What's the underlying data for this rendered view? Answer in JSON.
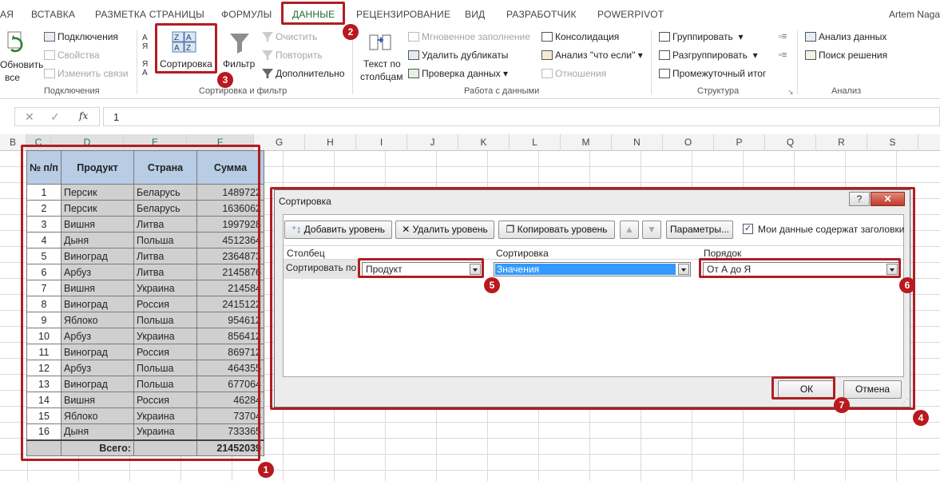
{
  "tabs": {
    "items": [
      "АЯ",
      "ВСТАВКА",
      "РАЗМЕТКА СТРАНИЦЫ",
      "ФОРМУЛЫ",
      "ДАННЫЕ",
      "РЕЦЕНЗИРОВАНИЕ",
      "ВИД",
      "РАЗРАБОТЧИК",
      "POWERPIVOT"
    ],
    "user": "Artem Naga"
  },
  "ribbon": {
    "connections": {
      "refresh_line1": "Обновить",
      "refresh_line2": "все",
      "connections": "Подключения",
      "properties": "Свойства",
      "edit_links": "Изменить связи",
      "group": "Подключения"
    },
    "sort": {
      "sort": "Сортировка",
      "filter": "Фильтр",
      "clear": "Очистить",
      "reapply": "Повторить",
      "advanced": "Дополнительно",
      "group": "Сортировка и фильтр"
    },
    "data_tools": {
      "text_to_cols1": "Текст по",
      "text_to_cols2": "столбцам",
      "flash_fill": "Мгновенное заполнение",
      "remove_dup": "Удалить дубликаты",
      "validation": "Проверка данных",
      "consolidate": "Консолидация",
      "whatif": "Анализ \"что если\"",
      "relations": "Отношения",
      "group": "Работа с данными"
    },
    "outline": {
      "group_btn": "Группировать",
      "ungroup": "Разгруппировать",
      "subtotal": "Промежуточный итог",
      "group": "Структура"
    },
    "analysis": {
      "data_analysis": "Анализ данных",
      "solver": "Поиск решения",
      "group": "Анализ"
    }
  },
  "formula": {
    "fx": "fx",
    "value": "1"
  },
  "columns": [
    "B",
    "C",
    "D",
    "E",
    "F",
    "G",
    "H",
    "I",
    "J",
    "K",
    "L",
    "M",
    "N",
    "O",
    "P",
    "Q",
    "R",
    "S"
  ],
  "table": {
    "headers": [
      "№ п/п",
      "Продукт",
      "Страна",
      "Сумма"
    ],
    "rows": [
      [
        "1",
        "Персик",
        "Беларусь",
        "1489722"
      ],
      [
        "2",
        "Персик",
        "Беларусь",
        "1636062"
      ],
      [
        "3",
        "Вишня",
        "Литва",
        "1997928"
      ],
      [
        "4",
        "Дыня",
        "Польша",
        "4512364"
      ],
      [
        "5",
        "Виноград",
        "Литва",
        "2364873"
      ],
      [
        "6",
        "Арбуз",
        "Литва",
        "2145876"
      ],
      [
        "7",
        "Вишня",
        "Украина",
        "214584"
      ],
      [
        "8",
        "Виноград",
        "Россия",
        "2415122"
      ],
      [
        "9",
        "Яблоко",
        "Польша",
        "954612"
      ],
      [
        "10",
        "Арбуз",
        "Украина",
        "856412"
      ],
      [
        "11",
        "Виноград",
        "Россия",
        "869712"
      ],
      [
        "12",
        "Арбуз",
        "Польша",
        "464355"
      ],
      [
        "13",
        "Виноград",
        "Польша",
        "677064"
      ],
      [
        "14",
        "Вишня",
        "Россия",
        "46284"
      ],
      [
        "15",
        "Яблоко",
        "Украина",
        "73704"
      ],
      [
        "16",
        "Дыня",
        "Украина",
        "733365"
      ]
    ],
    "total_label": "Всего:",
    "total_value": "21452039"
  },
  "dialog": {
    "title": "Сортировка",
    "help": "?",
    "add_level": "Добавить уровень",
    "delete_level": "Удалить уровень",
    "copy_level": "Копировать уровень",
    "options": "Параметры...",
    "has_headers": "Мои данные содержат заголовки",
    "col_header": "Столбец",
    "sort_header": "Сортировка",
    "order_header": "Порядок",
    "sort_by": "Сортировать по",
    "column_value": "Продукт",
    "sort_on_value": "Значения",
    "order_value": "От А до Я",
    "ok": "ОК",
    "cancel": "Отмена"
  },
  "markers": [
    "1",
    "2",
    "3",
    "4",
    "5",
    "6",
    "7"
  ],
  "colors": {
    "accent": "#b01e23",
    "header_fill": "#b8cce4",
    "selection_fill": "#d0d0d0"
  }
}
